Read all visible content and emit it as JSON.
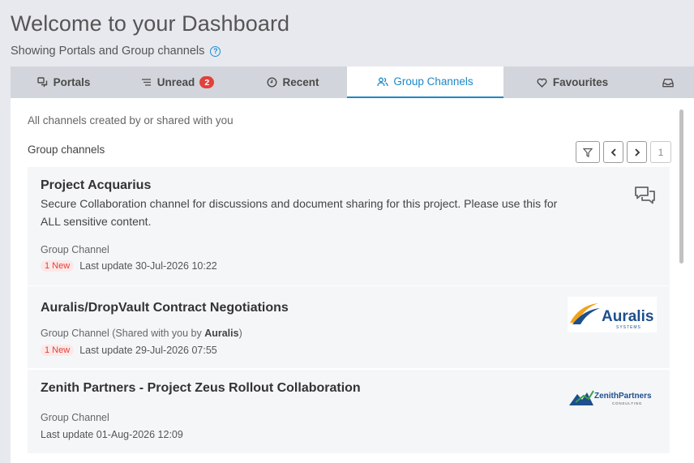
{
  "header": {
    "title": "Welcome to your Dashboard",
    "subtitle": "Showing Portals and Group channels"
  },
  "tabs": [
    {
      "label": "Portals",
      "icon": "portals-icon"
    },
    {
      "label": "Unread",
      "icon": "list-icon",
      "badge": "2"
    },
    {
      "label": "Recent",
      "icon": "clock-icon"
    },
    {
      "label": "Group Channels",
      "icon": "users-icon",
      "active": true
    },
    {
      "label": "Favourites",
      "icon": "heart-icon"
    },
    {
      "label": "",
      "icon": "inbox-icon"
    }
  ],
  "panel": {
    "description": "All channels created by or shared with you",
    "section_label": "Group channels",
    "pagination": {
      "current_page": "1"
    }
  },
  "channels": [
    {
      "title": "Project Acquarius",
      "description": "Secure Collaboration channel for discussions and document sharing for this project. Please use this for ALL sensitive content.",
      "type": "Group Channel",
      "new_badge": "1 New",
      "last_update": "Last update 30-Jul-2026 10:22"
    },
    {
      "title": "Auralis/DropVault Contract Negotiations",
      "type_prefix": "Group Channel (Shared with you by ",
      "shared_by": "Auralis",
      "type_suffix": ")",
      "new_badge": "1 New",
      "last_update": "Last update 29-Jul-2026 07:55",
      "logo_text": "Auralis",
      "logo_subtext": "SYSTEMS"
    },
    {
      "title": "Zenith Partners - Project Zeus Rollout Collaboration",
      "type": "Group Channel",
      "last_update": "Last update 01-Aug-2026 12:09",
      "logo_text": "ZenithPartners",
      "logo_subtext": "CONSULTING"
    }
  ],
  "colors": {
    "accent": "#1c88c8",
    "badge": "#e2413a",
    "tab_bar": "#d3d5dc",
    "page_bg": "#e8e9ef",
    "card_bg": "#f5f6f8"
  }
}
